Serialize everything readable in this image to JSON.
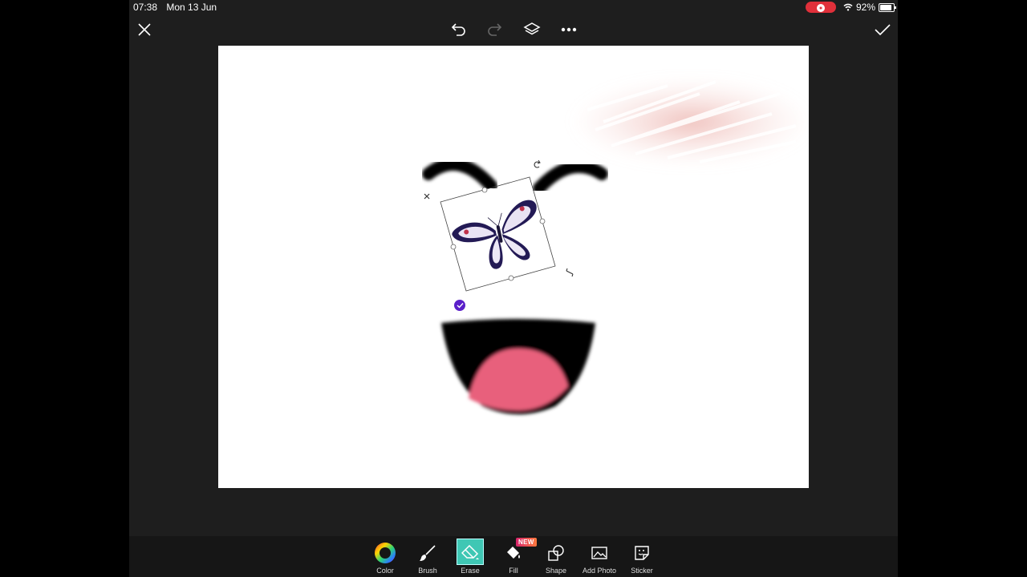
{
  "status_bar": {
    "time": "07:38",
    "date": "Mon 13 Jun",
    "battery": "92%"
  },
  "toolbar": {
    "close_icon": "close-icon",
    "undo_icon": "undo-icon",
    "redo_icon": "redo-icon",
    "layers_icon": "layers-icon",
    "more_icon": "more-icon",
    "confirm_icon": "check-icon"
  },
  "tools": [
    {
      "label": "Color",
      "icon": "color-wheel-icon"
    },
    {
      "label": "Brush",
      "icon": "brush-icon"
    },
    {
      "label": "Erase",
      "icon": "eraser-icon",
      "active": true
    },
    {
      "label": "Fill",
      "icon": "fill-bucket-icon",
      "badge": "NEW"
    },
    {
      "label": "Shape",
      "icon": "shape-icon"
    },
    {
      "label": "Add Photo",
      "icon": "add-photo-icon"
    },
    {
      "label": "Sticker",
      "icon": "sticker-icon"
    }
  ],
  "colors": {
    "accent": "#3fc7b4",
    "record": "#e0303a",
    "confirm_badge": "#5a1fc9",
    "mouth_tongue": "#e8607b"
  }
}
